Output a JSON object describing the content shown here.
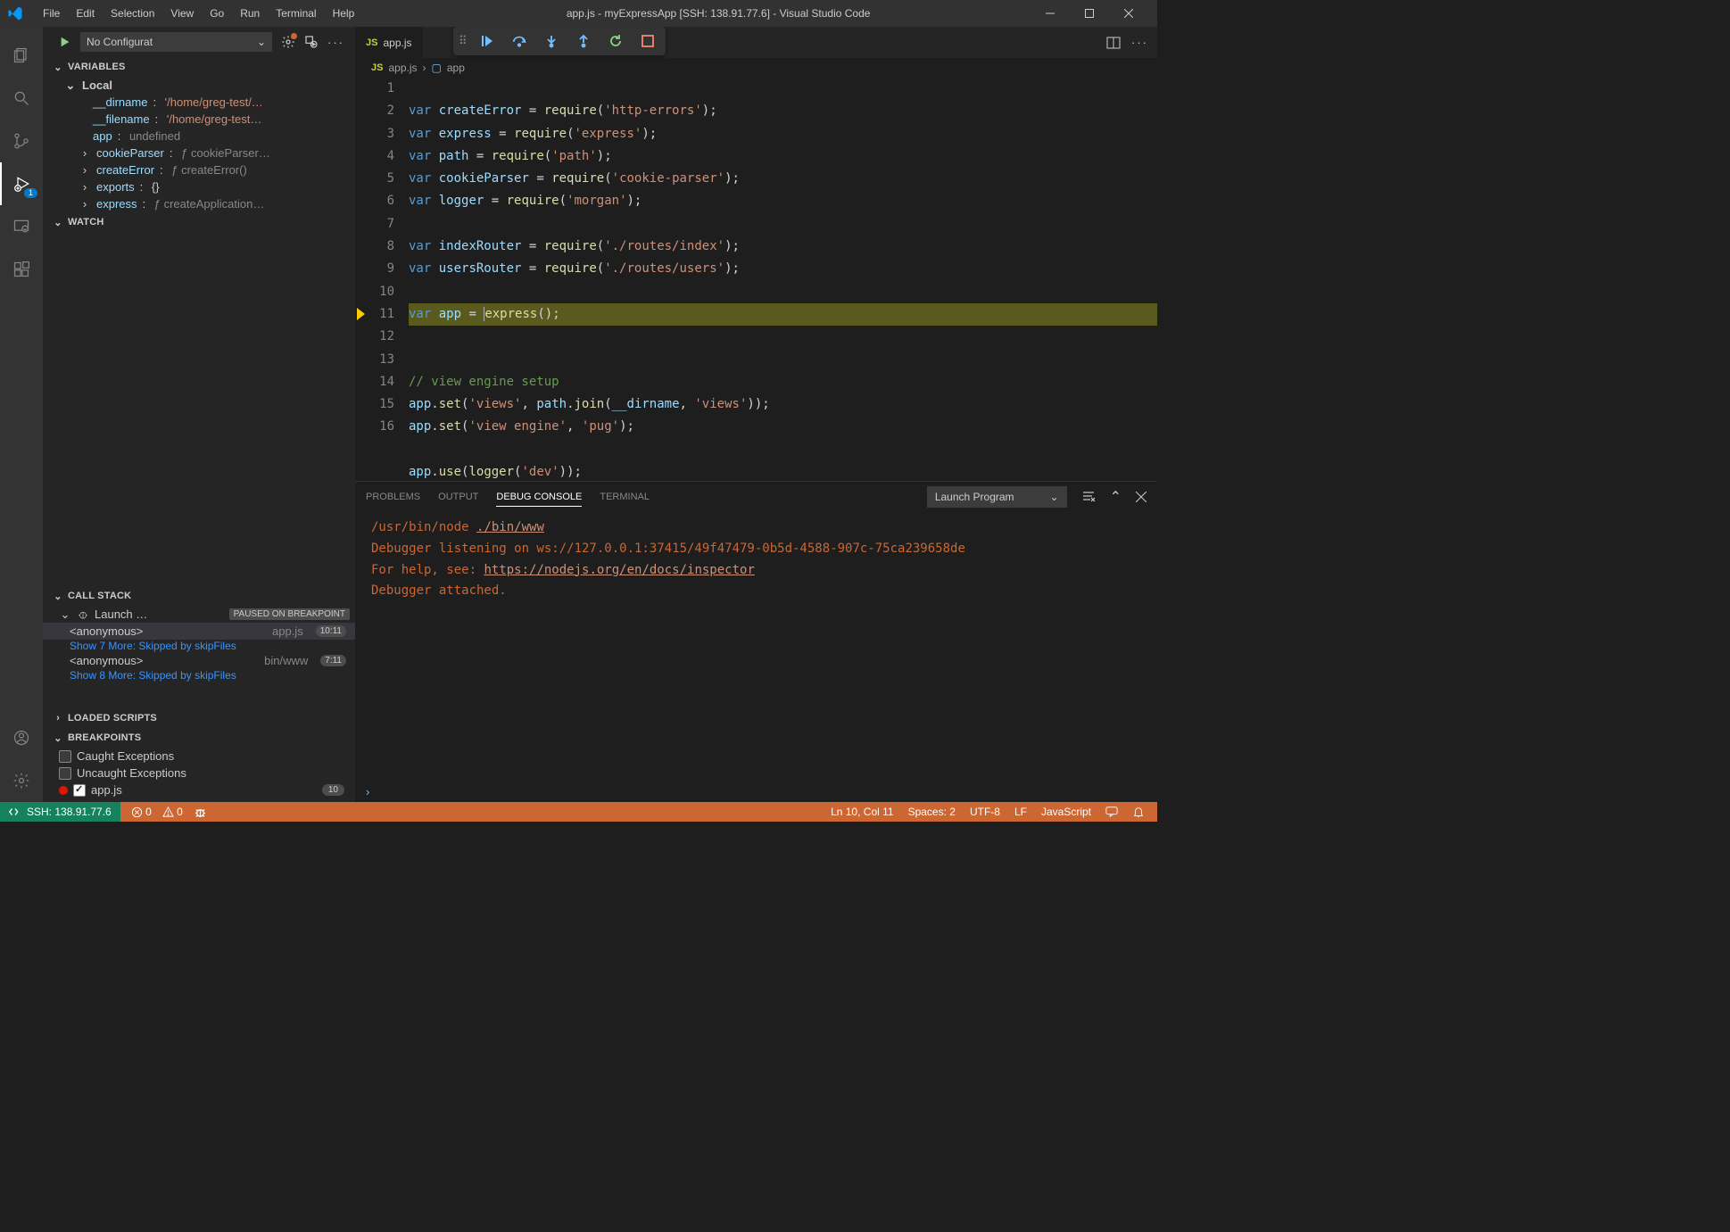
{
  "title": "app.js - myExpressApp [SSH: 138.91.77.6] - Visual Studio Code",
  "menu": [
    "File",
    "Edit",
    "Selection",
    "View",
    "Go",
    "Run",
    "Terminal",
    "Help"
  ],
  "debug": {
    "config_label": "No Configurat",
    "badge": "1",
    "sessions": {
      "variables_title": "VARIABLES",
      "scope_local": "Local",
      "vars": [
        {
          "name": "__dirname",
          "val": "'/home/greg-test/…",
          "kind": "str"
        },
        {
          "name": "__filename",
          "val": "'/home/greg-test…",
          "kind": "str"
        },
        {
          "name": "app",
          "val": "undefined",
          "kind": "undef"
        },
        {
          "name": "cookieParser",
          "val": "ƒ cookieParser…",
          "kind": "fn",
          "exp": true
        },
        {
          "name": "createError",
          "val": "ƒ createError()",
          "kind": "fn",
          "exp": true
        },
        {
          "name": "exports",
          "val": "{}",
          "kind": "obj",
          "exp": true
        },
        {
          "name": "express",
          "val": "ƒ createApplication…",
          "kind": "fn",
          "exp": true
        }
      ],
      "watch_title": "WATCH",
      "callstack_title": "CALL STACK",
      "session_name": "Launch …",
      "paused_label": "PAUSED ON BREAKPOINT",
      "frames": [
        {
          "label": "<anonymous>",
          "file": "app.js",
          "line": "10:11",
          "selected": true
        },
        {
          "skip": "Show 7 More: Skipped by skipFiles"
        },
        {
          "label": "<anonymous>",
          "file": "bin/www",
          "line": "7:11"
        },
        {
          "skip": "Show 8 More: Skipped by skipFiles"
        }
      ],
      "loaded_title": "LOADED SCRIPTS",
      "breakpoints_title": "BREAKPOINTS",
      "bps": [
        {
          "label": "Caught Exceptions",
          "checked": false,
          "type": "except"
        },
        {
          "label": "Uncaught Exceptions",
          "checked": false,
          "type": "except"
        },
        {
          "label": "app.js",
          "checked": true,
          "type": "file",
          "count": "10"
        }
      ]
    }
  },
  "tabs": [
    {
      "name": "app.js"
    }
  ],
  "breadcrumb": {
    "file": "app.js",
    "symbol": "app"
  },
  "code": {
    "lines": [
      "var createError = require('http-errors');",
      "var express = require('express');",
      "var path = require('path');",
      "var cookieParser = require('cookie-parser');",
      "var logger = require('morgan');",
      "",
      "var indexRouter = require('./routes/index');",
      "var usersRouter = require('./routes/users');",
      "",
      "var app = express();",
      "",
      "// view engine setup",
      "app.set('views', path.join(__dirname, 'views'));",
      "app.set('view engine', 'pug');",
      "",
      "app.use(logger('dev'));"
    ],
    "current_line": 10
  },
  "panel": {
    "tabs": [
      "PROBLEMS",
      "OUTPUT",
      "DEBUG CONSOLE",
      "TERMINAL"
    ],
    "active": "DEBUG CONSOLE",
    "filter": "Launch Program",
    "console": [
      {
        "pre": "/usr/bin/node ",
        "link": "./bin/www"
      },
      {
        "txt": "Debugger listening on ws://127.0.0.1:37415/49f47479-0b5d-4588-907c-75ca239658de"
      },
      {
        "pre": "For help, see: ",
        "link": "https://nodejs.org/en/docs/inspector"
      },
      {
        "txt": "Debugger attached."
      }
    ]
  },
  "status": {
    "ssh": "SSH: 138.91.77.6",
    "errors": "0",
    "warnings": "0",
    "pos": "Ln 10, Col 11",
    "spaces": "Spaces: 2",
    "enc": "UTF-8",
    "eol": "LF",
    "lang": "JavaScript"
  }
}
